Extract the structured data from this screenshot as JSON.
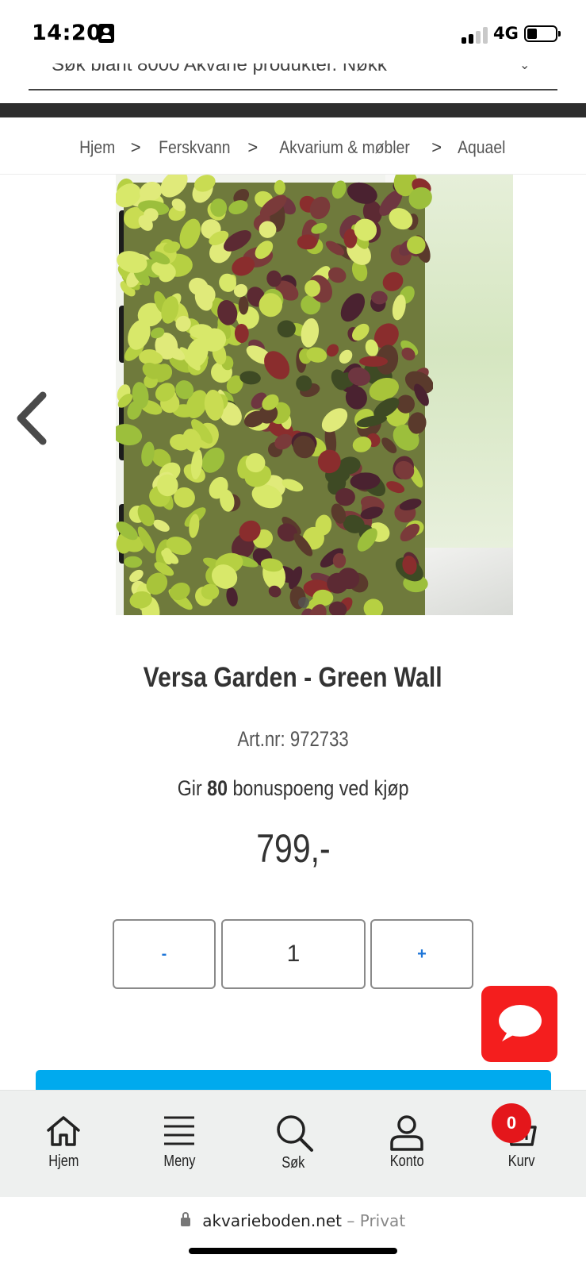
{
  "status_bar": {
    "time": "14:20",
    "network": "4G"
  },
  "search": {
    "placeholder": "Søk blant 8000 Akvarie produkter. Nøkk"
  },
  "breadcrumb": {
    "items": [
      "Hjem",
      "Ferskvann",
      "Akvarium & møbler",
      "Aquael"
    ],
    "separator": ">"
  },
  "product": {
    "title": "Versa Garden - Green Wall",
    "art_nr": "Art.nr: 972733",
    "bonus_prefix": "Gir",
    "bonus_points": "80",
    "bonus_suffix": "bonuspoeng ved kjøp",
    "price": "799,-",
    "image_alt": "Versa Garden green wall with plants"
  },
  "quantity": {
    "minus_label": "-",
    "value": "1",
    "plus_label": "+"
  },
  "bottom_nav": {
    "items": [
      {
        "label": "Hjem",
        "icon": "home-icon"
      },
      {
        "label": "Meny",
        "icon": "menu-icon"
      },
      {
        "label": "Søk",
        "icon": "search-icon"
      },
      {
        "label": "Konto",
        "icon": "user-icon"
      },
      {
        "label": "Kurv",
        "icon": "basket-icon"
      }
    ],
    "cart_count": "0"
  },
  "url_bar": {
    "domain": "akvarieboden.net",
    "separator": "–",
    "mode": "Privat"
  },
  "colors": {
    "accent_blue": "#00aaee",
    "chat_red": "#f41e1e",
    "badge_red": "#e4161b",
    "qty_sign_blue": "#1d75d8"
  }
}
